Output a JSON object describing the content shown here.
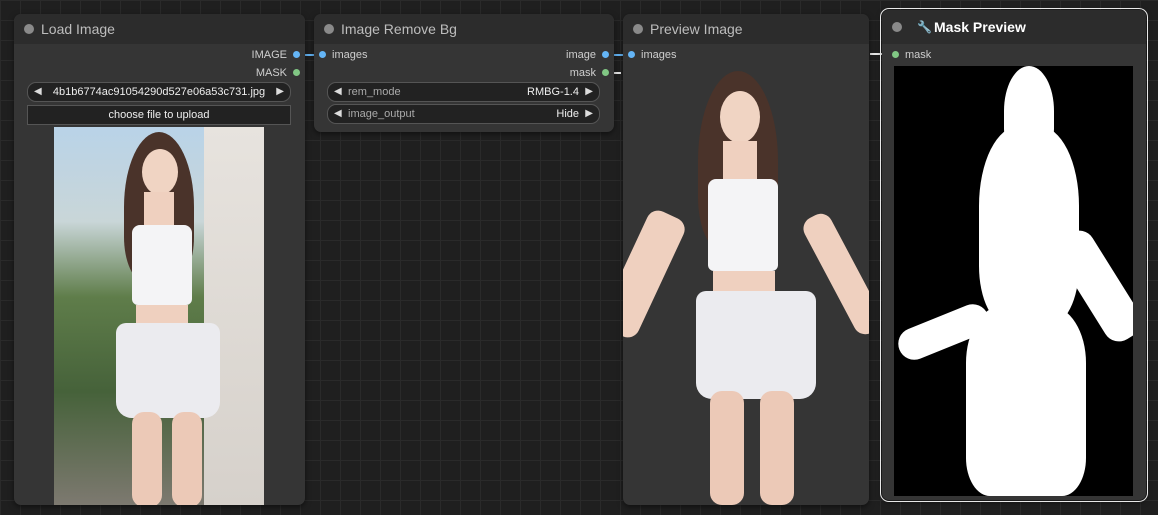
{
  "nodes": {
    "load_image": {
      "title": "Load Image",
      "outputs": [
        "IMAGE",
        "MASK"
      ],
      "file_widget": {
        "value": "4b1b6774ac91054290d527e06a53c731.jpg"
      },
      "upload_label": "choose file to upload"
    },
    "remove_bg": {
      "title": "Image Remove Bg",
      "input": "images",
      "outputs": [
        "image",
        "mask"
      ],
      "widgets": [
        {
          "name": "rem_mode",
          "value": "RMBG-1.4"
        },
        {
          "name": "image_output",
          "value": "Hide"
        }
      ]
    },
    "preview_image": {
      "title": "Preview Image",
      "input": "images"
    },
    "mask_preview": {
      "title": "Mask Preview",
      "input": "mask",
      "icon": "wrench-icon"
    }
  },
  "colors": {
    "image_slot": "#64b5f6",
    "mask_slot": "#81c784",
    "node_bg": "#353535",
    "canvas_bg": "#1f1f1f"
  }
}
